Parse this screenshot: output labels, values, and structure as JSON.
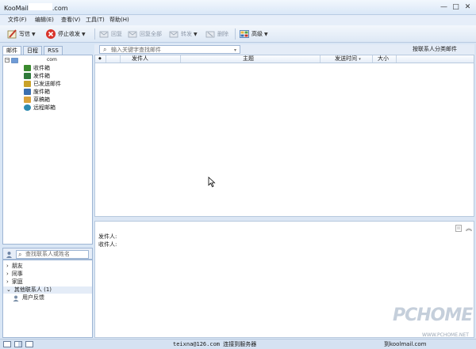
{
  "window": {
    "title_prefix": "KooMail",
    "title_suffix": ".com",
    "minimize": "—",
    "maximize": "□",
    "close": "✕"
  },
  "menu": [
    "文件(F)",
    "编辑(E)",
    "查看(V)",
    "工具(T)",
    "帮助(H)"
  ],
  "toolbar": {
    "compose": "写信",
    "stop": "停止收发",
    "reply": "回复",
    "reply_all": "回复全部",
    "forward": "转发",
    "delete": "删除",
    "advanced": "高级"
  },
  "tabs": [
    "邮件",
    "日程",
    "RSS"
  ],
  "account": {
    "label": "com"
  },
  "folders": [
    {
      "label": "收件箱",
      "icon": "inbox-icon",
      "color": "#3a8a2e"
    },
    {
      "label": "发件箱",
      "icon": "outbox-icon",
      "color": "#2f7a3a"
    },
    {
      "label": "已发送邮件",
      "icon": "sent-icon",
      "color": "#c9a22a"
    },
    {
      "label": "废件箱",
      "icon": "trash-icon",
      "color": "#3b6fb0"
    },
    {
      "label": "草稿箱",
      "icon": "drafts-icon",
      "color": "#d9a23b"
    },
    {
      "label": "远程邮箱",
      "icon": "remote-icon",
      "color": "#2e8bb0"
    }
  ],
  "contacts": {
    "search_placeholder": "查找联系人或姓名",
    "groups": [
      {
        "label": "朋友",
        "expanded": false
      },
      {
        "label": "同事",
        "expanded": false
      },
      {
        "label": "家庭",
        "expanded": false
      },
      {
        "label": "其他联系人 (1)",
        "expanded": true
      }
    ],
    "members": [
      {
        "label": "用户反馈"
      }
    ]
  },
  "mail_search": {
    "placeholder": "输入关键字查找邮件"
  },
  "group_by": "按联系人分类邮件",
  "columns": {
    "flag": "◆",
    "sender": "发件人",
    "subject": "主题",
    "date": "发送时间",
    "size": "大小"
  },
  "preview": {
    "from_label": "发件人:",
    "to_label": "收件人:"
  },
  "status": {
    "text": "teixna@126.com 连接到服务器",
    "right": "到koolmail.com",
    "watermark": "PCHOME",
    "watermark_url": "WWW.PCHOME.NET"
  },
  "colors": {
    "accent": "#3b6fb0",
    "border": "#9fb6d4",
    "panel_bg": "#d9e6f5"
  }
}
